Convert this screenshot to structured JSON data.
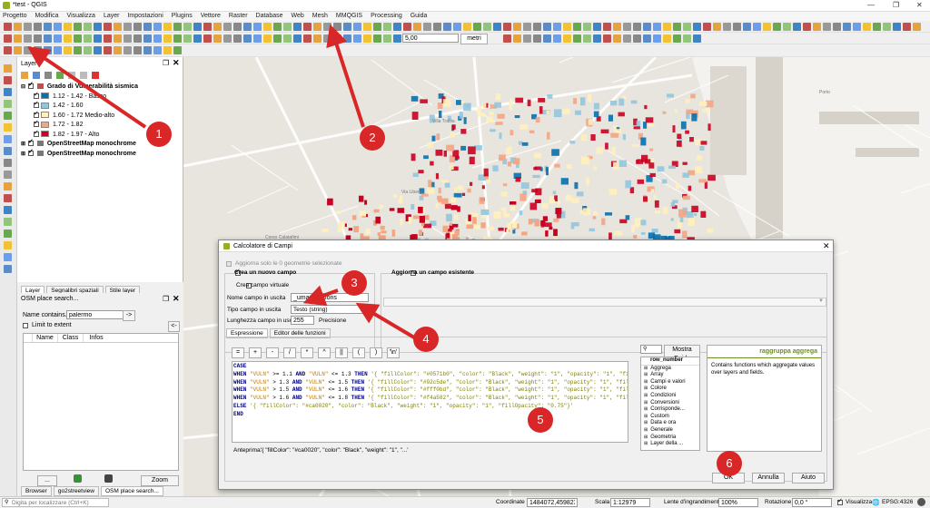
{
  "window": {
    "title": "*test - QGIS",
    "controls": [
      "—",
      "❐",
      "✕"
    ]
  },
  "menu": [
    "Progetto",
    "Modifica",
    "Visualizza",
    "Layer",
    "Impostazioni",
    "Plugins",
    "Vettore",
    "Raster",
    "Database",
    "Web",
    "Mesh",
    "MMQGIS",
    "Processing",
    "Guida"
  ],
  "toolbar": {
    "scale_value": "5,00",
    "unit": "metri"
  },
  "layers_panel": {
    "title": "Layer",
    "group": "Grado di Vulnerabilità sismica",
    "classes": [
      {
        "label": "1.12 - 1.42 - Basso",
        "color": "#0571b0"
      },
      {
        "label": "1.42 - 1.60",
        "color": "#92c5de"
      },
      {
        "label": "1.60 - 1.72  Medio-alto",
        "color": "#fff0bd"
      },
      {
        "label": "1.72 - 1.82",
        "color": "#f4a582"
      },
      {
        "label": "1.82 - 1.97 - Alto",
        "color": "#ca0020"
      }
    ],
    "basemaps": [
      "OpenStreetMap monochrome",
      "OpenStreetMap monochrome"
    ],
    "tabs": [
      "Layer",
      "Segnalibri spaziali",
      "Stile layer"
    ]
  },
  "osm_panel": {
    "title": "OSM place search...",
    "name_label": "Name contains...",
    "name_value": "palermo",
    "go": "->",
    "limit": "Limit to extent",
    "back": "<-",
    "columns": [
      "Name",
      "Class",
      "Infos"
    ],
    "zoom": "Zoom",
    "bottom_tabs": [
      "Browser",
      "go2streetview",
      "OSM place search..."
    ]
  },
  "map": {
    "city_labels": [
      "Villa Trabia",
      "Corso Calatafimi",
      "Via Libertà",
      "Porto"
    ]
  },
  "dialog": {
    "title": "Calcolatore di Campi",
    "only_selected": "Aggiorna solo le 0 geometrie selezionate",
    "create_new": "Crea un nuovo campo",
    "virtual": "Crea campo virtuale",
    "update_existing": "Aggiorna un campo esistente",
    "name_label": "Nome campo in uscita",
    "name_value": "_umap_options",
    "type_label": "Tipo campo in uscita",
    "type_value": "Testo (string)",
    "length_label": "Lunghezza campo in uscita",
    "length_value": "255",
    "precision_label": "Precisione",
    "tabs": [
      "Espressione",
      "Editor delle funzioni"
    ],
    "operators": [
      "=",
      "+",
      "-",
      "/",
      "*",
      "^",
      "||",
      "(",
      ")",
      "'\\n'"
    ],
    "expression": [
      [
        [
          "kw",
          "CASE"
        ]
      ],
      [
        [
          "kw",
          "WHEN "
        ],
        [
          "fld",
          "\"VULN\""
        ],
        [
          "op",
          " >= 1.1 "
        ],
        [
          "kw",
          "AND "
        ],
        [
          "fld",
          "\"VULN\""
        ],
        [
          "op",
          " <= 1.3 "
        ],
        [
          "kw",
          "THEN "
        ],
        [
          "str",
          "'{ \"fillColor\": \"#0571b0\", \"color\": \"Black\", \"weight\": \"1\", \"opacity\": \"1\", \"fillOpacity\": \"0.75\" }'"
        ]
      ],
      [
        [
          "kw",
          "WHEN "
        ],
        [
          "fld",
          "\"VULN\""
        ],
        [
          "op",
          " > 1.3 "
        ],
        [
          "kw",
          "AND "
        ],
        [
          "fld",
          "\"VULN\""
        ],
        [
          "op",
          " <= 1.5 "
        ],
        [
          "kw",
          "THEN "
        ],
        [
          "str",
          "'{ \"fillColor\": \"#92c5de\", \"color\": \"Black\", \"weight\": \"1\", \"opacity\": \"1\", \"fillOpacity\": \"0.75\" }'"
        ]
      ],
      [
        [
          "kw",
          "WHEN "
        ],
        [
          "fld",
          "\"VULN\""
        ],
        [
          "op",
          " > 1.5 "
        ],
        [
          "kw",
          "AND "
        ],
        [
          "fld",
          "\"VULN\""
        ],
        [
          "op",
          " <= 1.6 "
        ],
        [
          "kw",
          "THEN "
        ],
        [
          "str",
          "'{ \"fillColor\": \"#fff0bd\", \"color\": \"Black\", \"weight\": \"1\", \"opacity\": \"1\", \"fillOpacity\": \"0.75\" }'"
        ]
      ],
      [
        [
          "kw",
          "WHEN "
        ],
        [
          "fld",
          "\"VULN\""
        ],
        [
          "op",
          " > 1.6 "
        ],
        [
          "kw",
          "AND "
        ],
        [
          "fld",
          "\"VULN\""
        ],
        [
          "op",
          " <= 1.8 "
        ],
        [
          "kw",
          "THEN "
        ],
        [
          "str",
          "'{ \"fillColor\": \"#f4a582\", \"color\": \"Black\", \"weight\": \"1\", \"opacity\": \"1\", \"fillOpacity\": \"0.75\" }'"
        ]
      ],
      [
        [
          "kw",
          "ELSE "
        ],
        [
          "str",
          "'{ \"fillColor\": \"#ca0020\", \"color\": \"Black\", \"weight\": \"1\", \"opacity\": \"1\", \"fillOpacity\": \"0.75\"}'"
        ]
      ],
      [
        [
          "kw",
          "END"
        ]
      ]
    ],
    "preview_label": "Anteprima:",
    "preview_value": "'{ \"fillColor\": \"#ca0020\", \"color\": \"Black\", \"weight\": \"1\", \"...'",
    "search_placeholder": "",
    "help_button": "Mostra Guida",
    "functions": [
      "row_number",
      "Aggrega",
      "Array",
      "Campi e valori",
      "Colore",
      "Condizioni",
      "Conversioni",
      "Corrisponde...",
      "Custom",
      "Data e ora",
      "Generale",
      "Geometria",
      "Layer della ..."
    ],
    "help_title": "raggruppa aggrega",
    "help_text": "Contains functions which aggregate values over layers and fields.",
    "ok": "OK",
    "cancel": "Annulla",
    "help": "Aiuto"
  },
  "status": {
    "locator_placeholder": "Digita per localizzare (Ctrl+K)",
    "coord_label": "Coordinate",
    "coord_value": "1484072,4598233",
    "scale_label": "Scala",
    "scale_value": "1:12979",
    "magnifier_label": "Lente d'ingrandimento",
    "magnifier_value": "100%",
    "rotation_label": "Rotazione",
    "rotation_value": "0,0 °",
    "render_label": "Visualizza",
    "crs": "EPSG:4326"
  },
  "markers": [
    "1",
    "2",
    "3",
    "4",
    "5",
    "6"
  ],
  "colors": {
    "marker": "#d92626",
    "accent_title": "#6b8e23"
  }
}
